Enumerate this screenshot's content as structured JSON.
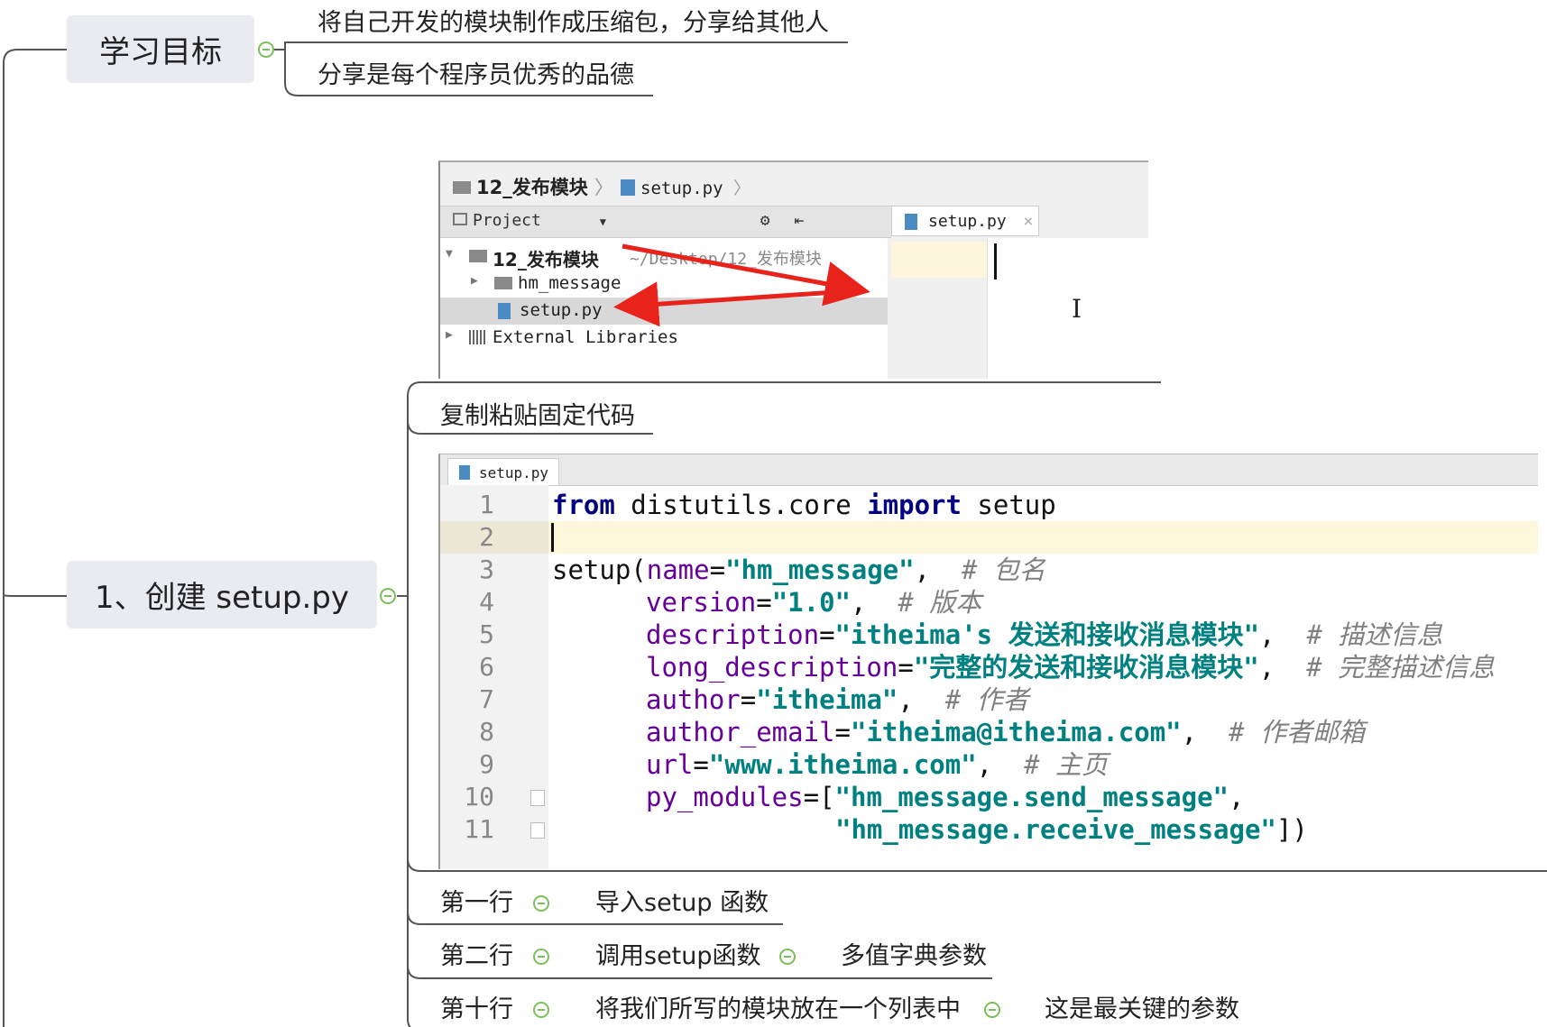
{
  "topics": {
    "goal": "学习目标",
    "create": "1、创建 setup.py"
  },
  "goal_items": [
    "将自己开发的模块制作成压缩包，分享给其他人",
    "分享是每个程序员优秀的品德"
  ],
  "step_label": "复制粘贴固定代码",
  "notes": {
    "line1_key": "第一行",
    "line1_val": "导入setup 函数",
    "line2_key": "第二行",
    "line2_val": "调用setup函数",
    "line2_extra": "多值字典参数",
    "line10_key": "第十行",
    "line10_val": "将我们所写的模块放在一个列表中",
    "line10_extra": "这是最关键的参数"
  },
  "ide1": {
    "breadcrumb_folder": "12_发布模块",
    "breadcrumb_file": "setup.py",
    "project_label": "Project",
    "tab_label": "setup.py",
    "tree": {
      "root": "12_发布模块",
      "root_path": "~/Desktop/12_发布模块",
      "pkg": "hm_message",
      "file": "setup.py",
      "libs": "External Libraries"
    }
  },
  "ide2": {
    "tab_label": "setup.py",
    "line_numbers": [
      "1",
      "2",
      "3",
      "4",
      "5",
      "6",
      "7",
      "8",
      "9",
      "10",
      "11"
    ],
    "code": {
      "l1_a": "from",
      "l1_b": " distutils.core ",
      "l1_c": "import",
      "l1_d": " setup",
      "l3_a": "setup(",
      "l3_b": "name",
      "l3_c": "=",
      "l3_d": "\"hm_message\"",
      "l3_e": ",  ",
      "l3_f": "# 包名",
      "l4_a": "version",
      "l4_b": "=",
      "l4_c": "\"1.0\"",
      "l4_d": ",  ",
      "l4_e": "# 版本",
      "l5_a": "description",
      "l5_b": "=",
      "l5_c": "\"itheima's 发送和接收消息模块\"",
      "l5_d": ",  ",
      "l5_e": "# 描述信息",
      "l6_a": "long_description",
      "l6_b": "=",
      "l6_c": "\"完整的发送和接收消息模块\"",
      "l6_d": ",  ",
      "l6_e": "# 完整描述信息",
      "l7_a": "author",
      "l7_b": "=",
      "l7_c": "\"itheima\"",
      "l7_d": ",  ",
      "l7_e": "# 作者",
      "l8_a": "author_email",
      "l8_b": "=",
      "l8_c": "\"itheima@itheima.com\"",
      "l8_d": ",  ",
      "l8_e": "# 作者邮箱",
      "l9_a": "url",
      "l9_b": "=",
      "l9_c": "\"www.itheima.com\"",
      "l9_d": ",  ",
      "l9_e": "# 主页",
      "l10_a": "py_modules",
      "l10_b": "=[",
      "l10_c": "\"hm_message.send_message\"",
      "l10_d": ",",
      "l11_a": "\"hm_message.receive_message\"",
      "l11_b": "])"
    }
  },
  "colors": {
    "topic_bg": "#e9ebf1",
    "collapse": "#7cbf5a",
    "arrow": "#e8231c",
    "keyword": "#000080",
    "param": "#660099",
    "string": "#008080",
    "comment": "#808080"
  }
}
